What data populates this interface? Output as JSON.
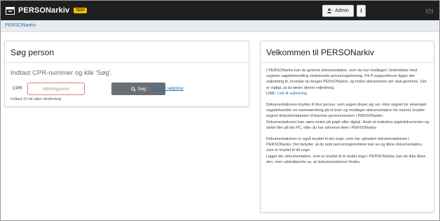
{
  "header": {
    "app_title": "PERSONarkiv",
    "badge": "TEST",
    "admin_label": "Admin",
    "info_label": "i"
  },
  "breadcrumb": {
    "home": "PERSONarkiv"
  },
  "search_card": {
    "title": "Søg person",
    "prompt": "Indtast CPR-nummer og klik 'Søg'.",
    "cpr_label": "CPR",
    "cpr_placeholder": "ddmmyyxxxx",
    "cpr_value": "",
    "search_button": "Søg",
    "advanced_link": "Nulstil søgning",
    "hint": "Indtast 10 tal uden bindestreg"
  },
  "welcome_card": {
    "title": "Velkommen til PERSONarkiv",
    "para1": "I PERSONarkiv kan du gemme dokumentation, som du har modtaget i forbindelse med sognets sagsbehandling vedrørende personregistrering. På P-supportforum ligger der vejledning til, hvordan du bruger PERSONarkiv, og hvilke dokumenter der skal gemmes. Det er vigtigt, at du læser denne vejledning.",
    "link_prefix": "LINK: ",
    "link_text": "Link til vejledning",
    "para2": "Dokumentationen knyttes til den person, som sagen drejer sig om. Hvis sognet for eksempel sagsbehandler en navneændring på et barn og modtager dokumentation for navnet, knytter sognet dokumentationen til barnets personnummer i PERSONarkiv.",
    "para3": "Dokumentationen kan være enten på papir eller digital. Husk at makulere papirdokumenter og slette filer på din PC, efter du har arkiveret dem i PERSONarkiv.",
    "para4": "Dokumentationen er også knyttet til det sogn, som har uploadet dokumentationen i PERSONarkiv. Det betyder, at du som personregisterfører kan se og åbne dokumentation, som er knyttet til dit sogn.",
    "para5": "Ligger der dokumentation, som er knyttet til et andet sogn i PERSONarkiv, kan du ikke åbne den, men udelukkende se, at dokumentationen findes."
  },
  "icons": {
    "brand": "archive-icon",
    "admin": "user-icon",
    "search": "search-icon",
    "crown": "crown-icon"
  },
  "colors": {
    "navbar": "#1f1f1f",
    "badge": "#f2c200",
    "link": "#2a6fb0",
    "search_button": "#6b6e72",
    "input_border_invalid": "#e07a82"
  }
}
